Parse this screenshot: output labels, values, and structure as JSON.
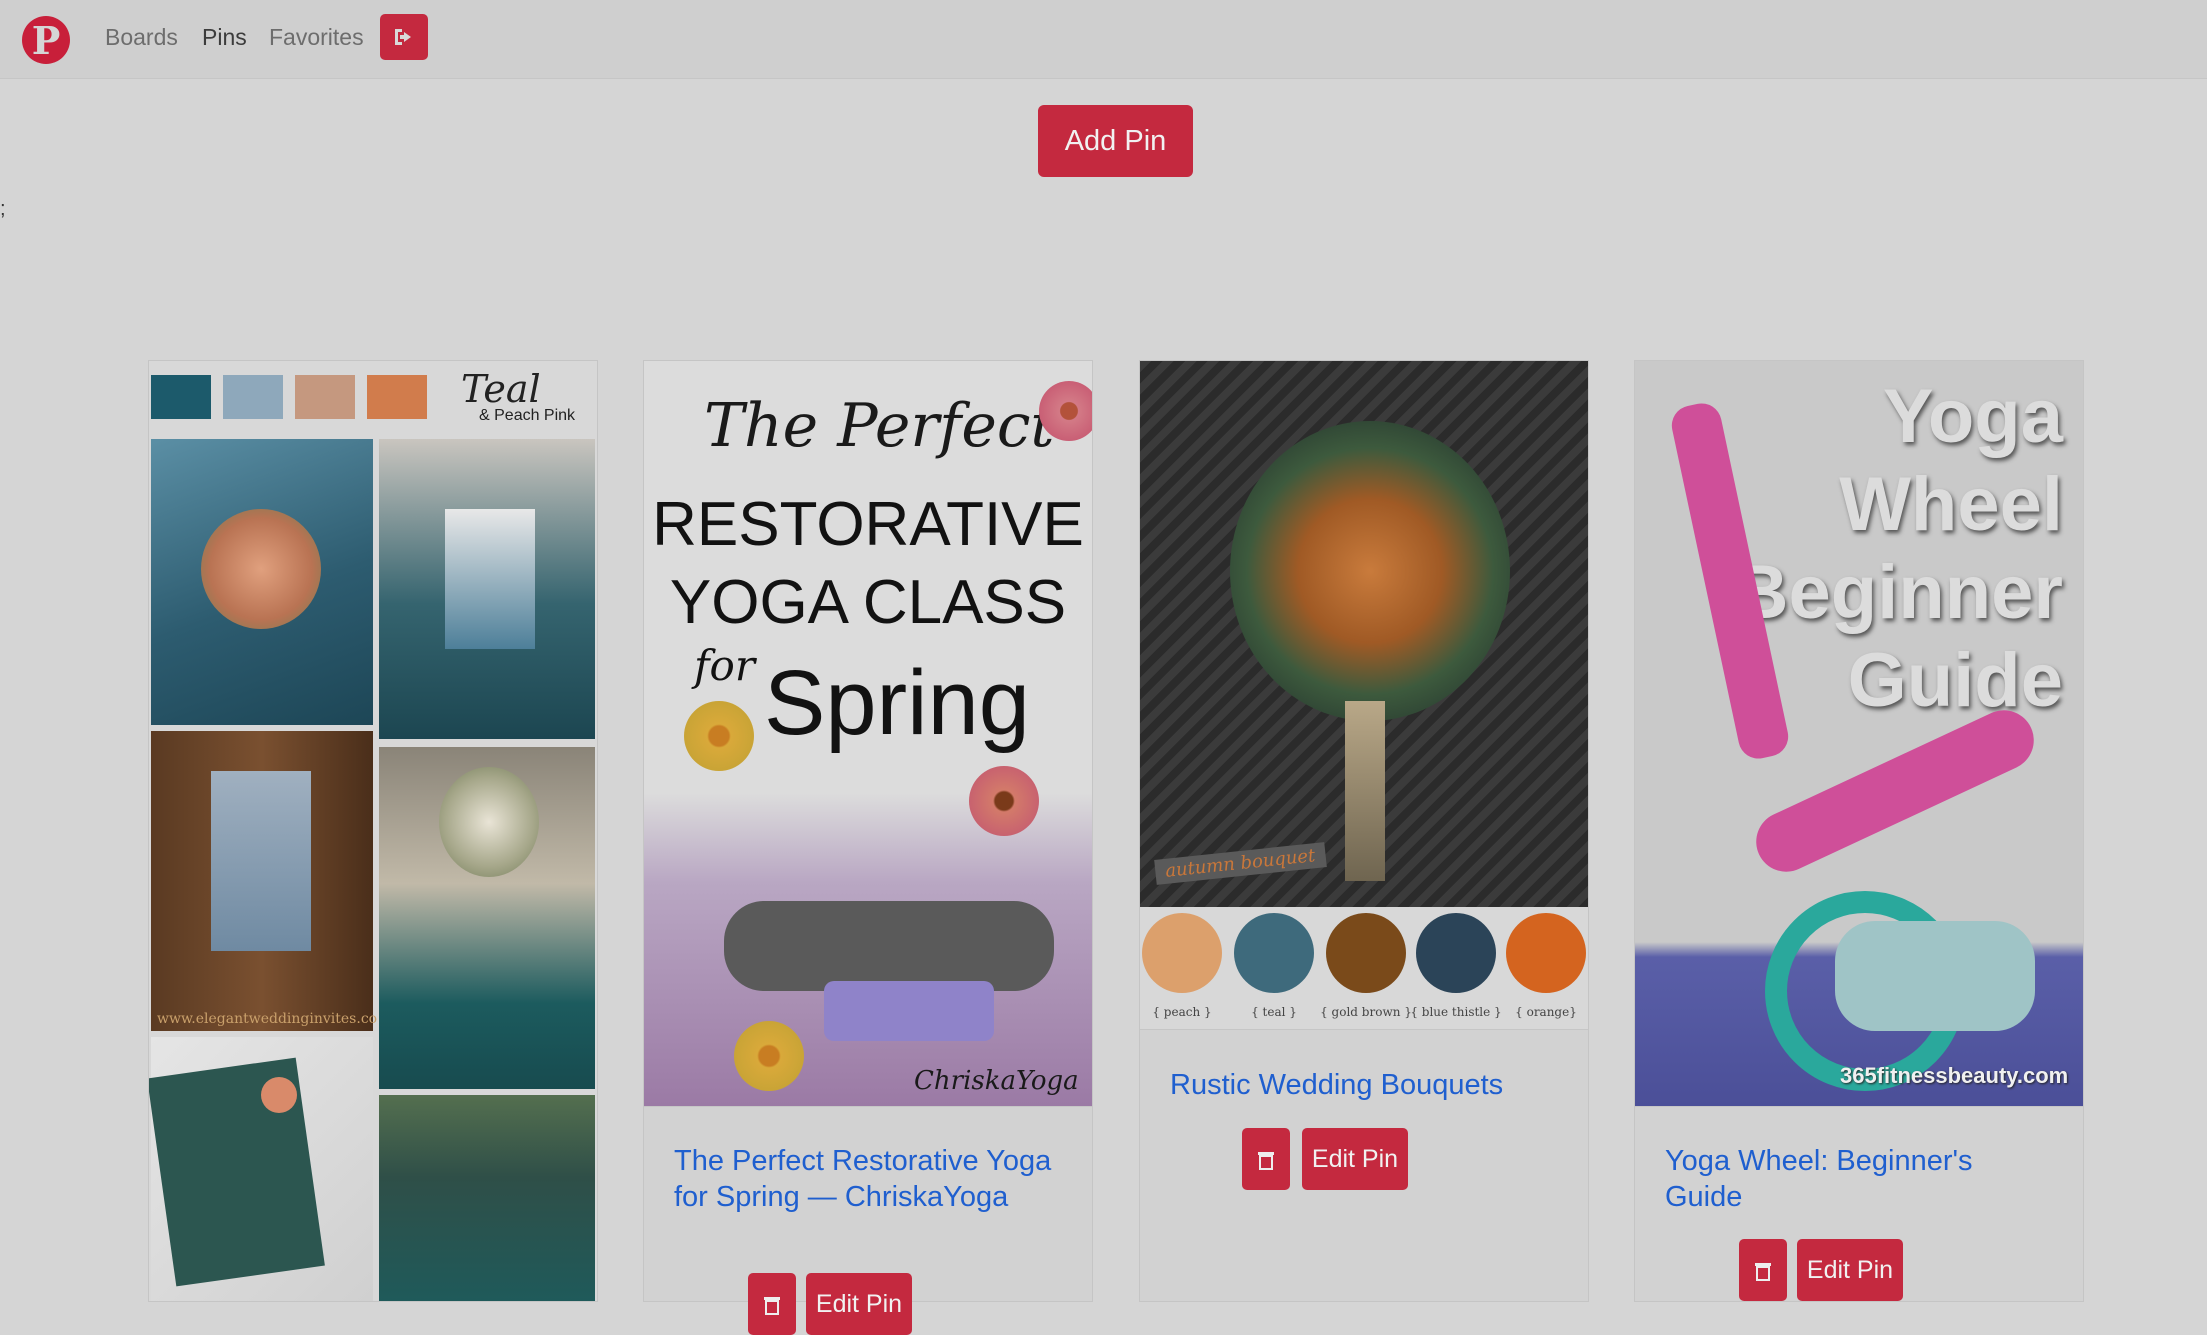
{
  "nav": {
    "logo_letter": "P",
    "links": [
      "Boards",
      "Pins",
      "Favorites"
    ],
    "logout_icon": "sign-out-icon"
  },
  "actions": {
    "add_pin": "Add Pin"
  },
  "stray_text": ";",
  "colors": {
    "accent": "#c4293f",
    "link": "#1f5fcf",
    "backdrop": "#d5d5d5"
  },
  "cards": [
    {
      "title": "",
      "image": {
        "swatches": [
          "#1c5a6b",
          "#8ea8bb",
          "#c5987f",
          "#d17c4c"
        ],
        "heading_script": "Teal",
        "heading_sub": "& Peach Pink",
        "watermark": "www.elegantweddinginvites.co"
      }
    },
    {
      "title": "The Perfect Restorative Yoga for Spring — ChriskaYoga",
      "image": {
        "script_line": "The Perfect",
        "line1": "RESTORATIVE",
        "line2": "YOGA CLASS",
        "for": "for",
        "line3": "Spring",
        "signature": "ChriskaYoga"
      },
      "edit_label": "Edit Pin"
    },
    {
      "title": "Rustic Wedding Bouquets",
      "image": {
        "tag": "autumn bouquet",
        "palette": [
          {
            "color": "#dca06c",
            "label": "{ peach }"
          },
          {
            "color": "#3e6a7c",
            "label": "{ teal }"
          },
          {
            "color": "#7a4a1a",
            "label": "{ gold brown }"
          },
          {
            "color": "#2b4458",
            "label": "{ blue thistle }"
          },
          {
            "color": "#d4641f",
            "label": "{ orange}"
          }
        ]
      },
      "edit_label": "Edit Pin"
    },
    {
      "title": "Yoga Wheel: Beginner's Guide",
      "image": {
        "lines": [
          "Yoga",
          "Wheel",
          "Beginner",
          "Guide"
        ],
        "watermark": "365fitnessbeauty.com"
      },
      "edit_label": "Edit Pin"
    }
  ]
}
